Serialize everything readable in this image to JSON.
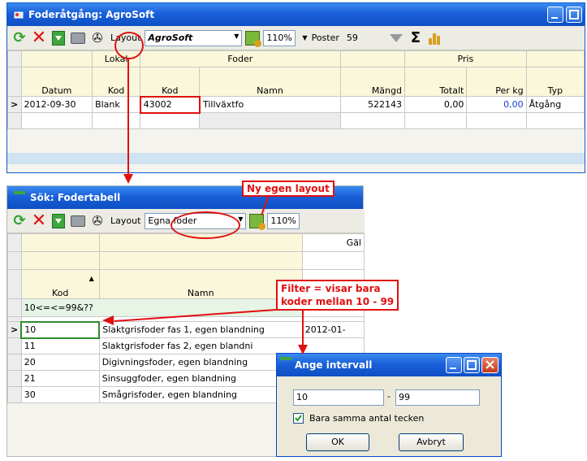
{
  "win1": {
    "title": "Foderåtgång: AgroSoft",
    "toolbar": {
      "layout_label": "Layout",
      "layout_value": "AgroSoft",
      "zoom": "110%",
      "poster_label": "Poster",
      "poster_count": "59"
    },
    "grid": {
      "group_headers": [
        "Lokal",
        "Foder",
        "Pris"
      ],
      "columns": [
        "Datum",
        "Kod",
        "Kod",
        "Namn",
        "Mängd",
        "Totalt",
        "Per kg",
        "Typ"
      ],
      "row": {
        "marker": ">",
        "datum": "2012-09-30",
        "lokal_kod": "Blank",
        "foder_kod": "43002",
        "namn": "Tillväxtfo",
        "mangd": "522143",
        "totalt": "0,00",
        "perkg": "0,00",
        "typ": "Åtgång"
      }
    }
  },
  "win2": {
    "title": "Sök: Fodertabell",
    "toolbar": {
      "layout_label": "Layout",
      "layout_value": "Egna foder",
      "zoom": "110%"
    },
    "grid": {
      "group_header": "Gäl",
      "col_kod": "Kod",
      "col_namn": "Namn",
      "filter": "10<=<=99&??",
      "rows": [
        {
          "marker": ">",
          "kod": "10",
          "namn": "Slaktgrisfoder fas 1, egen blandning",
          "extra": "2012-01-"
        },
        {
          "marker": "",
          "kod": "11",
          "namn": "Slaktgrisfoder fas 2, egen blandni",
          "extra": ""
        },
        {
          "marker": "",
          "kod": "20",
          "namn": "Digivningsfoder, egen blandning",
          "extra": ""
        },
        {
          "marker": "",
          "kod": "21",
          "namn": "Sinsuggfoder, egen blandning",
          "extra": ""
        },
        {
          "marker": "",
          "kod": "30",
          "namn": "Smågrisfoder, egen blandning",
          "extra": ""
        }
      ]
    }
  },
  "dialog": {
    "title": "Ange intervall",
    "from": "10",
    "separator": "-",
    "to": "99",
    "checkbox_label": "Bara samma antal tecken",
    "checkbox_checked": true,
    "ok": "OK",
    "cancel": "Avbryt"
  },
  "callouts": {
    "layout": "Ny egen layout",
    "filter_line1": "Filter = visar bara",
    "filter_line2": "koder mellan 10 - 99"
  },
  "colors": {
    "titlebar": "#1a5fd8",
    "accent_red": "#e01010",
    "header_bg": "#faf7da"
  }
}
